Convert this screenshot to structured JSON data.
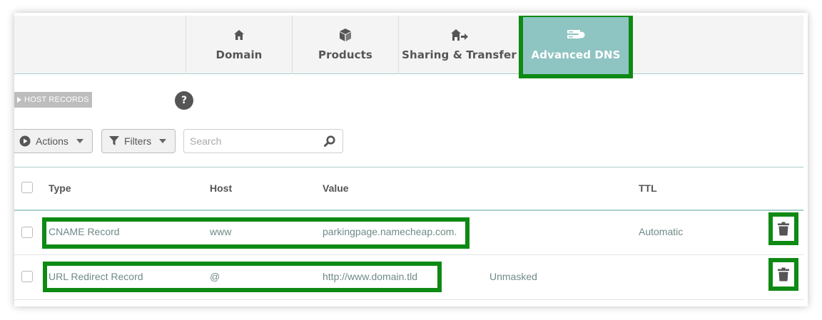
{
  "tabs": [
    {
      "label": "Domain",
      "icon": "home-icon"
    },
    {
      "label": "Products",
      "icon": "box-icon"
    },
    {
      "label": "Sharing & Transfer",
      "icon": "transfer-icon"
    },
    {
      "label": "Advanced DNS",
      "icon": "server-icon",
      "active": true
    }
  ],
  "section": {
    "label": "HOST RECORDS",
    "help": "?"
  },
  "toolbar": {
    "actions_label": "Actions",
    "filters_label": "Filters",
    "search_placeholder": "Search"
  },
  "table": {
    "headers": {
      "type": "Type",
      "host": "Host",
      "value": "Value",
      "ttl": "TTL"
    },
    "rows": [
      {
        "type": "CNAME Record",
        "host": "www",
        "value": "parkingpage.namecheap.com.",
        "extra": "",
        "ttl": "Automatic"
      },
      {
        "type": "URL Redirect Record",
        "host": "@",
        "value": "http://www.domain.tld",
        "extra": "Unmasked",
        "ttl": ""
      }
    ]
  },
  "colors": {
    "accent": "#8ec4c2",
    "highlight": "#0e8a14",
    "text": "#6f8a88"
  }
}
